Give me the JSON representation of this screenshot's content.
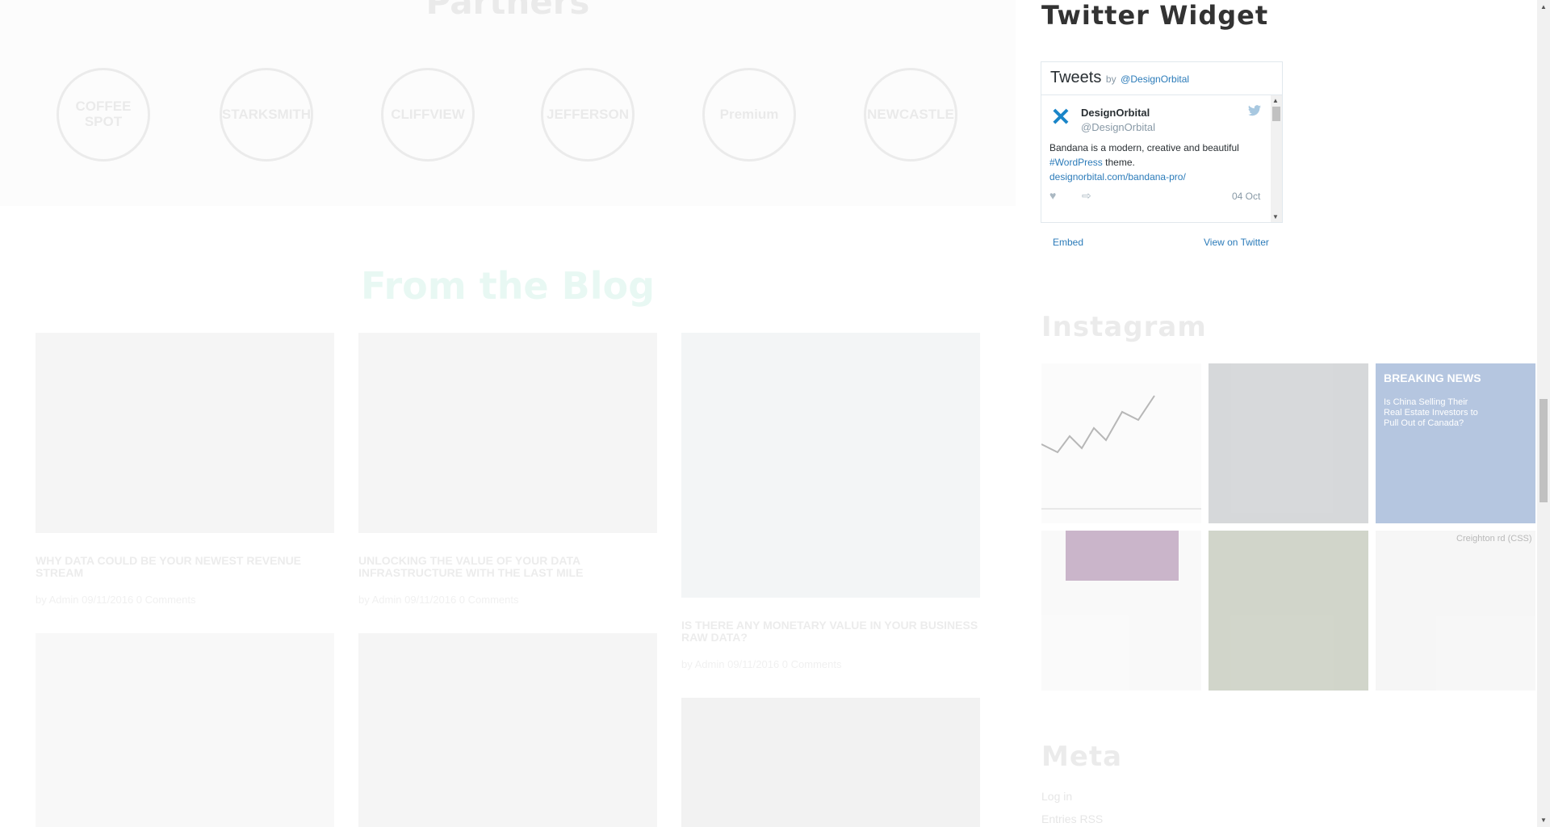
{
  "partners": {
    "title": "Partners",
    "logos": [
      "COFFEE SPOT",
      "STARKSMITH",
      "CLIFFVIEW",
      "JEFFERSON",
      "Premium",
      "NEWCASTLE"
    ]
  },
  "blog": {
    "title": "From the Blog",
    "posts": [
      {
        "title": "WHY DATA COULD BE YOUR NEWEST REVENUE STREAM",
        "meta": "by Admin  09/11/2016  0 Comments"
      },
      {
        "title": "UNLOCKING THE VALUE OF YOUR DATA INFRASTRUCTURE WITH THE LAST MILE",
        "meta": "by Admin  09/11/2016  0 Comments"
      },
      {
        "title": "IS THERE ANY MONETARY VALUE IN YOUR BUSINESS RAW DATA?",
        "meta": "by Admin  09/11/2016  0 Comments"
      }
    ]
  },
  "sidebar": {
    "twitter_title": "Twitter Widget",
    "instagram_title": "Instagram",
    "meta_title": "Meta",
    "meta_items": [
      "Log in",
      "Entries RSS"
    ]
  },
  "twitter": {
    "header": "Tweets",
    "by": "by",
    "handle_link": "@DesignOrbital",
    "tweet": {
      "name": "DesignOrbital",
      "handle": "@DesignOrbital",
      "text_1": "Bandana is a modern, creative and beautiful",
      "hashtag": "#WordPress",
      "text_2": " theme.",
      "url": "designorbital.com/bandana-pro/",
      "date": "04 Oct"
    },
    "embed": "Embed",
    "view": "View on Twitter"
  },
  "instagram": {
    "breaking": "BREAKING NEWS",
    "headline": "Is China Selling Their Real Estate Investors to Pull Out of Canada?",
    "listing": "Creighton rd (CSS)"
  },
  "icons": {
    "avatar": "x-logo-icon",
    "bird": "twitter-bird-icon",
    "like": "heart-icon",
    "share": "share-icon"
  }
}
